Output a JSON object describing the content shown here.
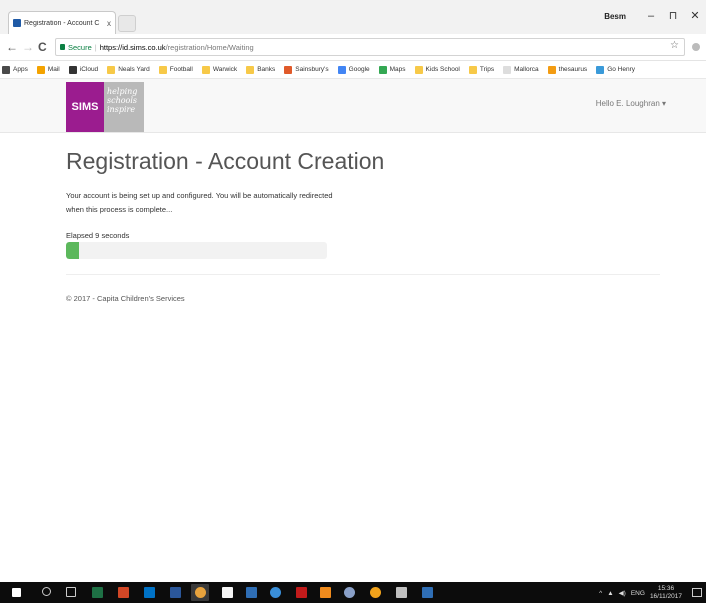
{
  "browser": {
    "tab_title": "Registration - Account C",
    "tab_close": "x",
    "window_user": "Besm",
    "window_controls": [
      "–",
      "⊓",
      "✕"
    ],
    "nav_back": "←",
    "nav_forward": "→",
    "nav_reload": "C",
    "secure_label": "Secure",
    "url_scheme_host": "https://id.sims.co.uk",
    "url_path": "/registration/Home/Waiting",
    "star_icon": "☆",
    "bookmarks": [
      {
        "label": "Apps",
        "color": "#4a4a4a"
      },
      {
        "label": "Mail",
        "color": "#f4a300"
      },
      {
        "label": "iCloud",
        "color": "#333333"
      },
      {
        "label": "Neals Yard",
        "color": "#f7c948"
      },
      {
        "label": "Football",
        "color": "#f7c948"
      },
      {
        "label": "Warwick",
        "color": "#f7c948"
      },
      {
        "label": "Banks",
        "color": "#f7c948"
      },
      {
        "label": "Sainsbury's",
        "color": "#e05a2a"
      },
      {
        "label": "Google",
        "color": "#4285f4"
      },
      {
        "label": "Maps",
        "color": "#34a853"
      },
      {
        "label": "Kids School",
        "color": "#f7c948"
      },
      {
        "label": "Trips",
        "color": "#f7c948"
      },
      {
        "label": "Mallorca",
        "color": "#dddddd"
      },
      {
        "label": "thesaurus",
        "color": "#f39c12"
      },
      {
        "label": "Go Henry",
        "color": "#3a9ad9"
      }
    ]
  },
  "site": {
    "logo_text": "SIMS",
    "logo_tagline_1": "helping",
    "logo_tagline_2": "schools",
    "logo_tagline_3": "inspire",
    "user_menu": "Hello E. Loughran ▾",
    "brand_color": "#9b1c8f"
  },
  "main": {
    "title": "Registration - Account Creation",
    "message_line1": "Your account is being set up and configured. You will be automatically redirected",
    "message_line2": "when this process is complete...",
    "elapsed": "Elapsed 9 seconds",
    "progress_fraction": 0.05,
    "progress_color": "#5cb85c"
  },
  "footer": {
    "copyright": "© 2017 - Capita Children's Services"
  },
  "taskbar": {
    "lang": "ENG",
    "time": "15:36",
    "date": "16/11/2017"
  }
}
